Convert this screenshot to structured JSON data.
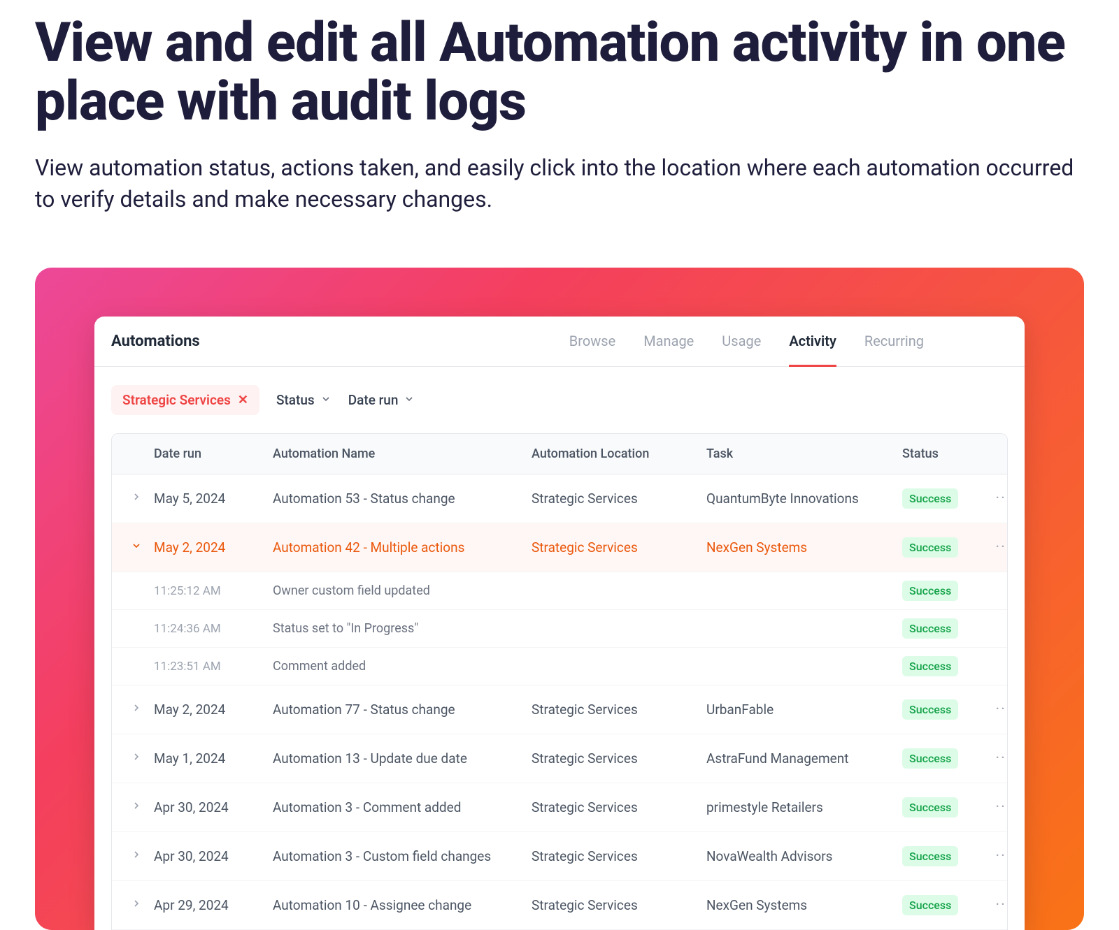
{
  "hero": {
    "title": "View and edit all Automation activity in one place with audit logs",
    "subtitle": "View automation status, actions taken, and easily click into the location where each automation occurred to verify details and make necessary changes."
  },
  "app": {
    "title": "Automations",
    "tabs": [
      "Browse",
      "Manage",
      "Usage",
      "Activity",
      "Recurring"
    ],
    "active_tab": "Activity",
    "filters": {
      "chip": "Strategic Services",
      "status_label": "Status",
      "date_label": "Date run"
    },
    "columns": {
      "date": "Date run",
      "name": "Automation Name",
      "location": "Automation Location",
      "task": "Task",
      "status": "Status"
    },
    "rows": [
      {
        "expanded": false,
        "date": "May 5, 2024",
        "name": "Automation 53 - Status change",
        "location": "Strategic Services",
        "task": "QuantumByte Innovations",
        "status": "Success"
      },
      {
        "expanded": true,
        "date": "May 2, 2024",
        "name": "Automation 42 - Multiple actions",
        "location": "Strategic Services",
        "task": "NexGen Systems",
        "status": "Success",
        "sub": [
          {
            "time": "11:25:12 AM",
            "action": "Owner custom field updated",
            "status": "Success"
          },
          {
            "time": "11:24:36 AM",
            "action": "Status set to \"In Progress\"",
            "status": "Success"
          },
          {
            "time": "11:23:51 AM",
            "action": "Comment added",
            "status": "Success"
          }
        ]
      },
      {
        "expanded": false,
        "date": "May 2, 2024",
        "name": "Automation 77 - Status change",
        "location": "Strategic Services",
        "task": "UrbanFable",
        "status": "Success"
      },
      {
        "expanded": false,
        "date": "May 1, 2024",
        "name": "Automation 13 - Update due date",
        "location": "Strategic Services",
        "task": "AstraFund Management",
        "status": "Success"
      },
      {
        "expanded": false,
        "date": "Apr 30, 2024",
        "name": "Automation 3 - Comment added",
        "location": "Strategic Services",
        "task": "primestyle Retailers",
        "status": "Success"
      },
      {
        "expanded": false,
        "date": "Apr 30, 2024",
        "name": "Automation 3 - Custom field changes",
        "location": "Strategic Services",
        "task": "NovaWealth Advisors",
        "status": "Success"
      },
      {
        "expanded": false,
        "date": "Apr 29, 2024",
        "name": "Automation 10 - Assignee change",
        "location": "Strategic Services",
        "task": "NexGen Systems",
        "status": "Success"
      }
    ]
  }
}
